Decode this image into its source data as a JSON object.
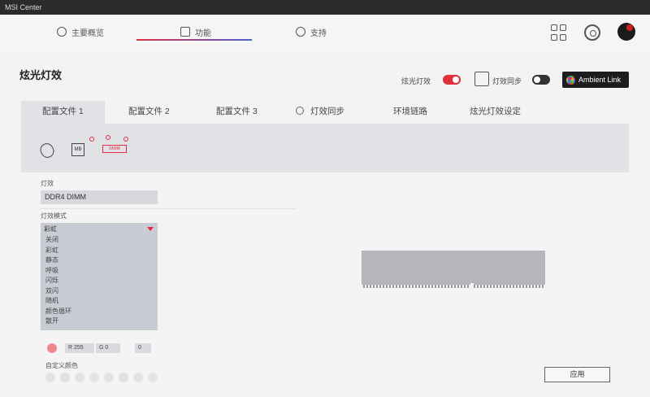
{
  "window": {
    "title": "MSI Center"
  },
  "nav": {
    "tabs": [
      {
        "label": "主要概览"
      },
      {
        "label": "功能"
      },
      {
        "label": "支持"
      }
    ],
    "active_index": 1
  },
  "page": {
    "title": "炫光灯效"
  },
  "toggles": {
    "lighting": {
      "label": "炫光灯效",
      "state": "on"
    },
    "sync": {
      "label": "灯效同步",
      "state": "off"
    }
  },
  "ambient_link": {
    "label": "Ambient Link"
  },
  "tabs": [
    {
      "label": "配置文件 1"
    },
    {
      "label": "配置文件 2"
    },
    {
      "label": "配置文件 3"
    },
    {
      "label": "灯效同步"
    },
    {
      "label": "环境链路"
    },
    {
      "label": "炫光灯效设定"
    }
  ],
  "devices": {
    "mb_label": "MB",
    "ram_label": "DIMM"
  },
  "device_field": {
    "label": "灯效",
    "value": "DDR4 DIMM"
  },
  "effect": {
    "label": "灯效模式",
    "selected": "彩虹",
    "options": [
      "关闭",
      "彩虹",
      "静态",
      "呼吸",
      "闪烁",
      "双闪",
      "随机",
      "颜色循环",
      "散开"
    ]
  },
  "color": {
    "swatch_hex": "#f08a8a",
    "r": "R 255",
    "g": "G 0",
    "b": "0"
  },
  "custom_colors": {
    "label": "自定义颜色"
  },
  "apply_button": {
    "label": "应用"
  },
  "colors": {
    "accent": "#e0303c",
    "active_tab_bg": "#e1e2e6"
  }
}
